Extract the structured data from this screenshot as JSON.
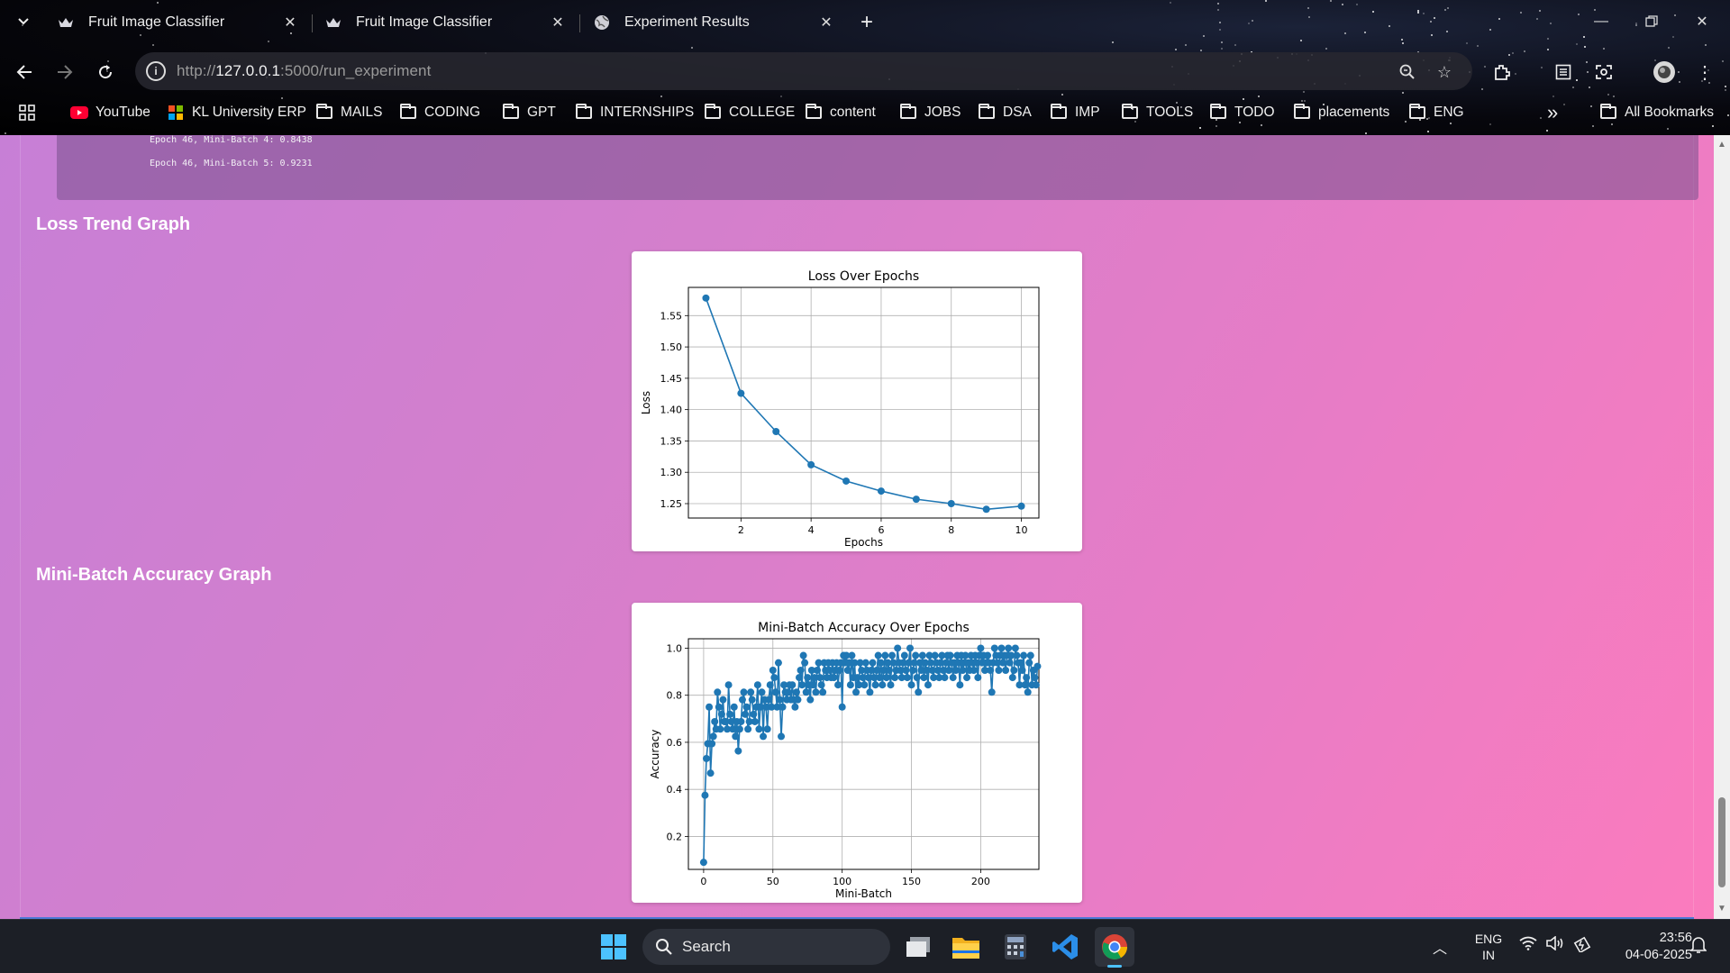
{
  "browser": {
    "tabs": [
      {
        "title": "Fruit Image Classifier",
        "icon": "crown-favicon"
      },
      {
        "title": "Fruit Image Classifier",
        "icon": "crown-favicon"
      },
      {
        "title": "Experiment Results",
        "icon": "globe-favicon"
      }
    ],
    "active_tab": 2,
    "url_prefix": "http://",
    "url_host": "127.0.0.1",
    "url_rest": ":5000/run_experiment",
    "bookmarks": [
      {
        "label": "YouTube",
        "icon": "youtube-icon"
      },
      {
        "label": "KL University ERP",
        "icon": "windows-logo-icon"
      },
      {
        "label": "MAILS",
        "icon": "folder-icon"
      },
      {
        "label": "CODING",
        "icon": "folder-icon"
      },
      {
        "label": "GPT",
        "icon": "folder-icon"
      },
      {
        "label": "INTERNSHIPS",
        "icon": "folder-icon"
      },
      {
        "label": "COLLEGE",
        "icon": "folder-icon"
      },
      {
        "label": "content",
        "icon": "folder-icon"
      },
      {
        "label": "JOBS",
        "icon": "folder-icon"
      },
      {
        "label": "DSA",
        "icon": "folder-icon"
      },
      {
        "label": "IMP",
        "icon": "folder-icon"
      },
      {
        "label": "TOOLS",
        "icon": "folder-icon"
      },
      {
        "label": "TODO",
        "icon": "folder-icon"
      },
      {
        "label": "placements",
        "icon": "folder-icon"
      },
      {
        "label": "ENG",
        "icon": "folder-icon"
      }
    ],
    "all_bookmarks_label": "All Bookmarks",
    "overflow_label": "»"
  },
  "page": {
    "log_lines": [
      "Epoch 46, Mini-Batch 4: 0.8438",
      "Epoch 46, Mini-Batch 5: 0.9231"
    ],
    "loss_section_title": "Loss Trend Graph",
    "acc_section_title": "Mini-Batch Accuracy Graph"
  },
  "chart_data": [
    {
      "type": "line",
      "title": "Loss Over Epochs",
      "xlabel": "Epochs",
      "ylabel": "Loss",
      "x": [
        1,
        2,
        3,
        4,
        5,
        6,
        7,
        8,
        9,
        10
      ],
      "y": [
        1.578,
        1.426,
        1.365,
        1.312,
        1.286,
        1.27,
        1.257,
        1.25,
        1.241,
        1.246
      ],
      "xlim": [
        0.5,
        10.5
      ],
      "ylim": [
        1.227,
        1.595
      ],
      "xticks": [
        2,
        4,
        6,
        8,
        10
      ],
      "yticks": [
        1.25,
        1.3,
        1.35,
        1.4,
        1.45,
        1.5,
        1.55
      ],
      "grid": true,
      "marker": "circle",
      "color": "#1f77b4"
    },
    {
      "type": "line",
      "title": "Mini-Batch Accuracy Over Epochs",
      "xlabel": "Mini-Batch",
      "ylabel": "Accuracy",
      "xlim": [
        -11,
        242
      ],
      "ylim": [
        0.06,
        1.04
      ],
      "xticks": [
        0,
        50,
        100,
        150,
        200
      ],
      "yticks": [
        0.2,
        0.4,
        0.6,
        0.8,
        1.0
      ],
      "grid": true,
      "marker": "circle",
      "color": "#1f77b4",
      "x_start": 0,
      "y": [
        0.09,
        0.375,
        0.531,
        0.594,
        0.75,
        0.469,
        0.594,
        0.625,
        0.688,
        0.656,
        0.813,
        0.75,
        0.656,
        0.719,
        0.781,
        0.688,
        0.688,
        0.656,
        0.844,
        0.719,
        0.688,
        0.656,
        0.75,
        0.625,
        0.688,
        0.563,
        0.656,
        0.688,
        0.781,
        0.813,
        0.719,
        0.75,
        0.656,
        0.688,
        0.813,
        0.781,
        0.719,
        0.688,
        0.75,
        0.844,
        0.656,
        0.75,
        0.813,
        0.625,
        0.781,
        0.75,
        0.656,
        0.781,
        0.844,
        0.75,
        0.906,
        0.875,
        0.813,
        0.75,
        0.938,
        0.781,
        0.625,
        0.75,
        0.844,
        0.813,
        0.781,
        0.813,
        0.844,
        0.781,
        0.844,
        0.781,
        0.75,
        0.813,
        0.781,
        0.875,
        0.906,
        0.844,
        0.969,
        0.938,
        0.813,
        0.875,
        0.844,
        0.781,
        0.906,
        0.844,
        0.875,
        0.813,
        0.906,
        0.938,
        0.875,
        0.844,
        0.813,
        0.938,
        0.906,
        0.875,
        0.938,
        0.906,
        0.875,
        0.938,
        0.875,
        0.906,
        0.938,
        0.844,
        0.906,
        0.938,
        0.75,
        0.969,
        0.938,
        0.969,
        0.906,
        0.938,
        0.844,
        0.969,
        0.875,
        0.938,
        0.813,
        0.875,
        0.844,
        0.938,
        0.906,
        0.875,
        0.844,
        0.938,
        0.906,
        0.875,
        0.813,
        0.906,
        0.938,
        0.875,
        0.844,
        0.906,
        0.969,
        0.875,
        0.938,
        0.844,
        0.906,
        0.969,
        0.875,
        0.938,
        0.906,
        0.844,
        0.969,
        0.938,
        0.875,
        0.906,
        1.0,
        0.938,
        0.906,
        0.875,
        0.938,
        0.969,
        0.906,
        0.875,
        0.938,
        1.0,
        0.844,
        0.906,
        0.938,
        0.969,
        0.875,
        0.813,
        0.938,
        0.906,
        0.969,
        0.875,
        0.938,
        0.906,
        0.844,
        0.969,
        0.938,
        0.906,
        0.875,
        0.969,
        0.938,
        0.906,
        0.875,
        0.938,
        0.969,
        0.906,
        0.875,
        0.938,
        0.969,
        0.906,
        0.969,
        0.938,
        0.875,
        0.938,
        0.906,
        0.969,
        0.938,
        0.844,
        0.969,
        0.906,
        0.938,
        0.969,
        0.875,
        0.938,
        0.906,
        0.969,
        0.938,
        0.906,
        0.969,
        0.938,
        0.875,
        0.969,
        1.0,
        0.938,
        0.969,
        0.906,
        0.938,
        0.969,
        0.938,
        0.906,
        0.813,
        0.938,
        1.0,
        0.969,
        0.938,
        0.906,
        0.969,
        1.0,
        0.938,
        0.969,
        0.906,
        0.969,
        1.0,
        0.938,
        0.969,
        0.875,
        0.906,
        1.0,
        0.969,
        0.938,
        0.844,
        0.938,
        0.906,
        0.969,
        0.844,
        0.875,
        0.813,
        0.938,
        0.969,
        0.844,
        0.906,
        0.875,
        0.844,
        0.923
      ]
    }
  ],
  "taskbar": {
    "search_label": "Search",
    "lang_line1": "ENG",
    "lang_line2": "IN",
    "time": "23:56",
    "date": "04-06-2025",
    "apps": [
      "windows-start-icon",
      "task-view-icon",
      "file-explorer-icon",
      "calculator-icon",
      "vscode-icon",
      "chrome-icon"
    ]
  }
}
